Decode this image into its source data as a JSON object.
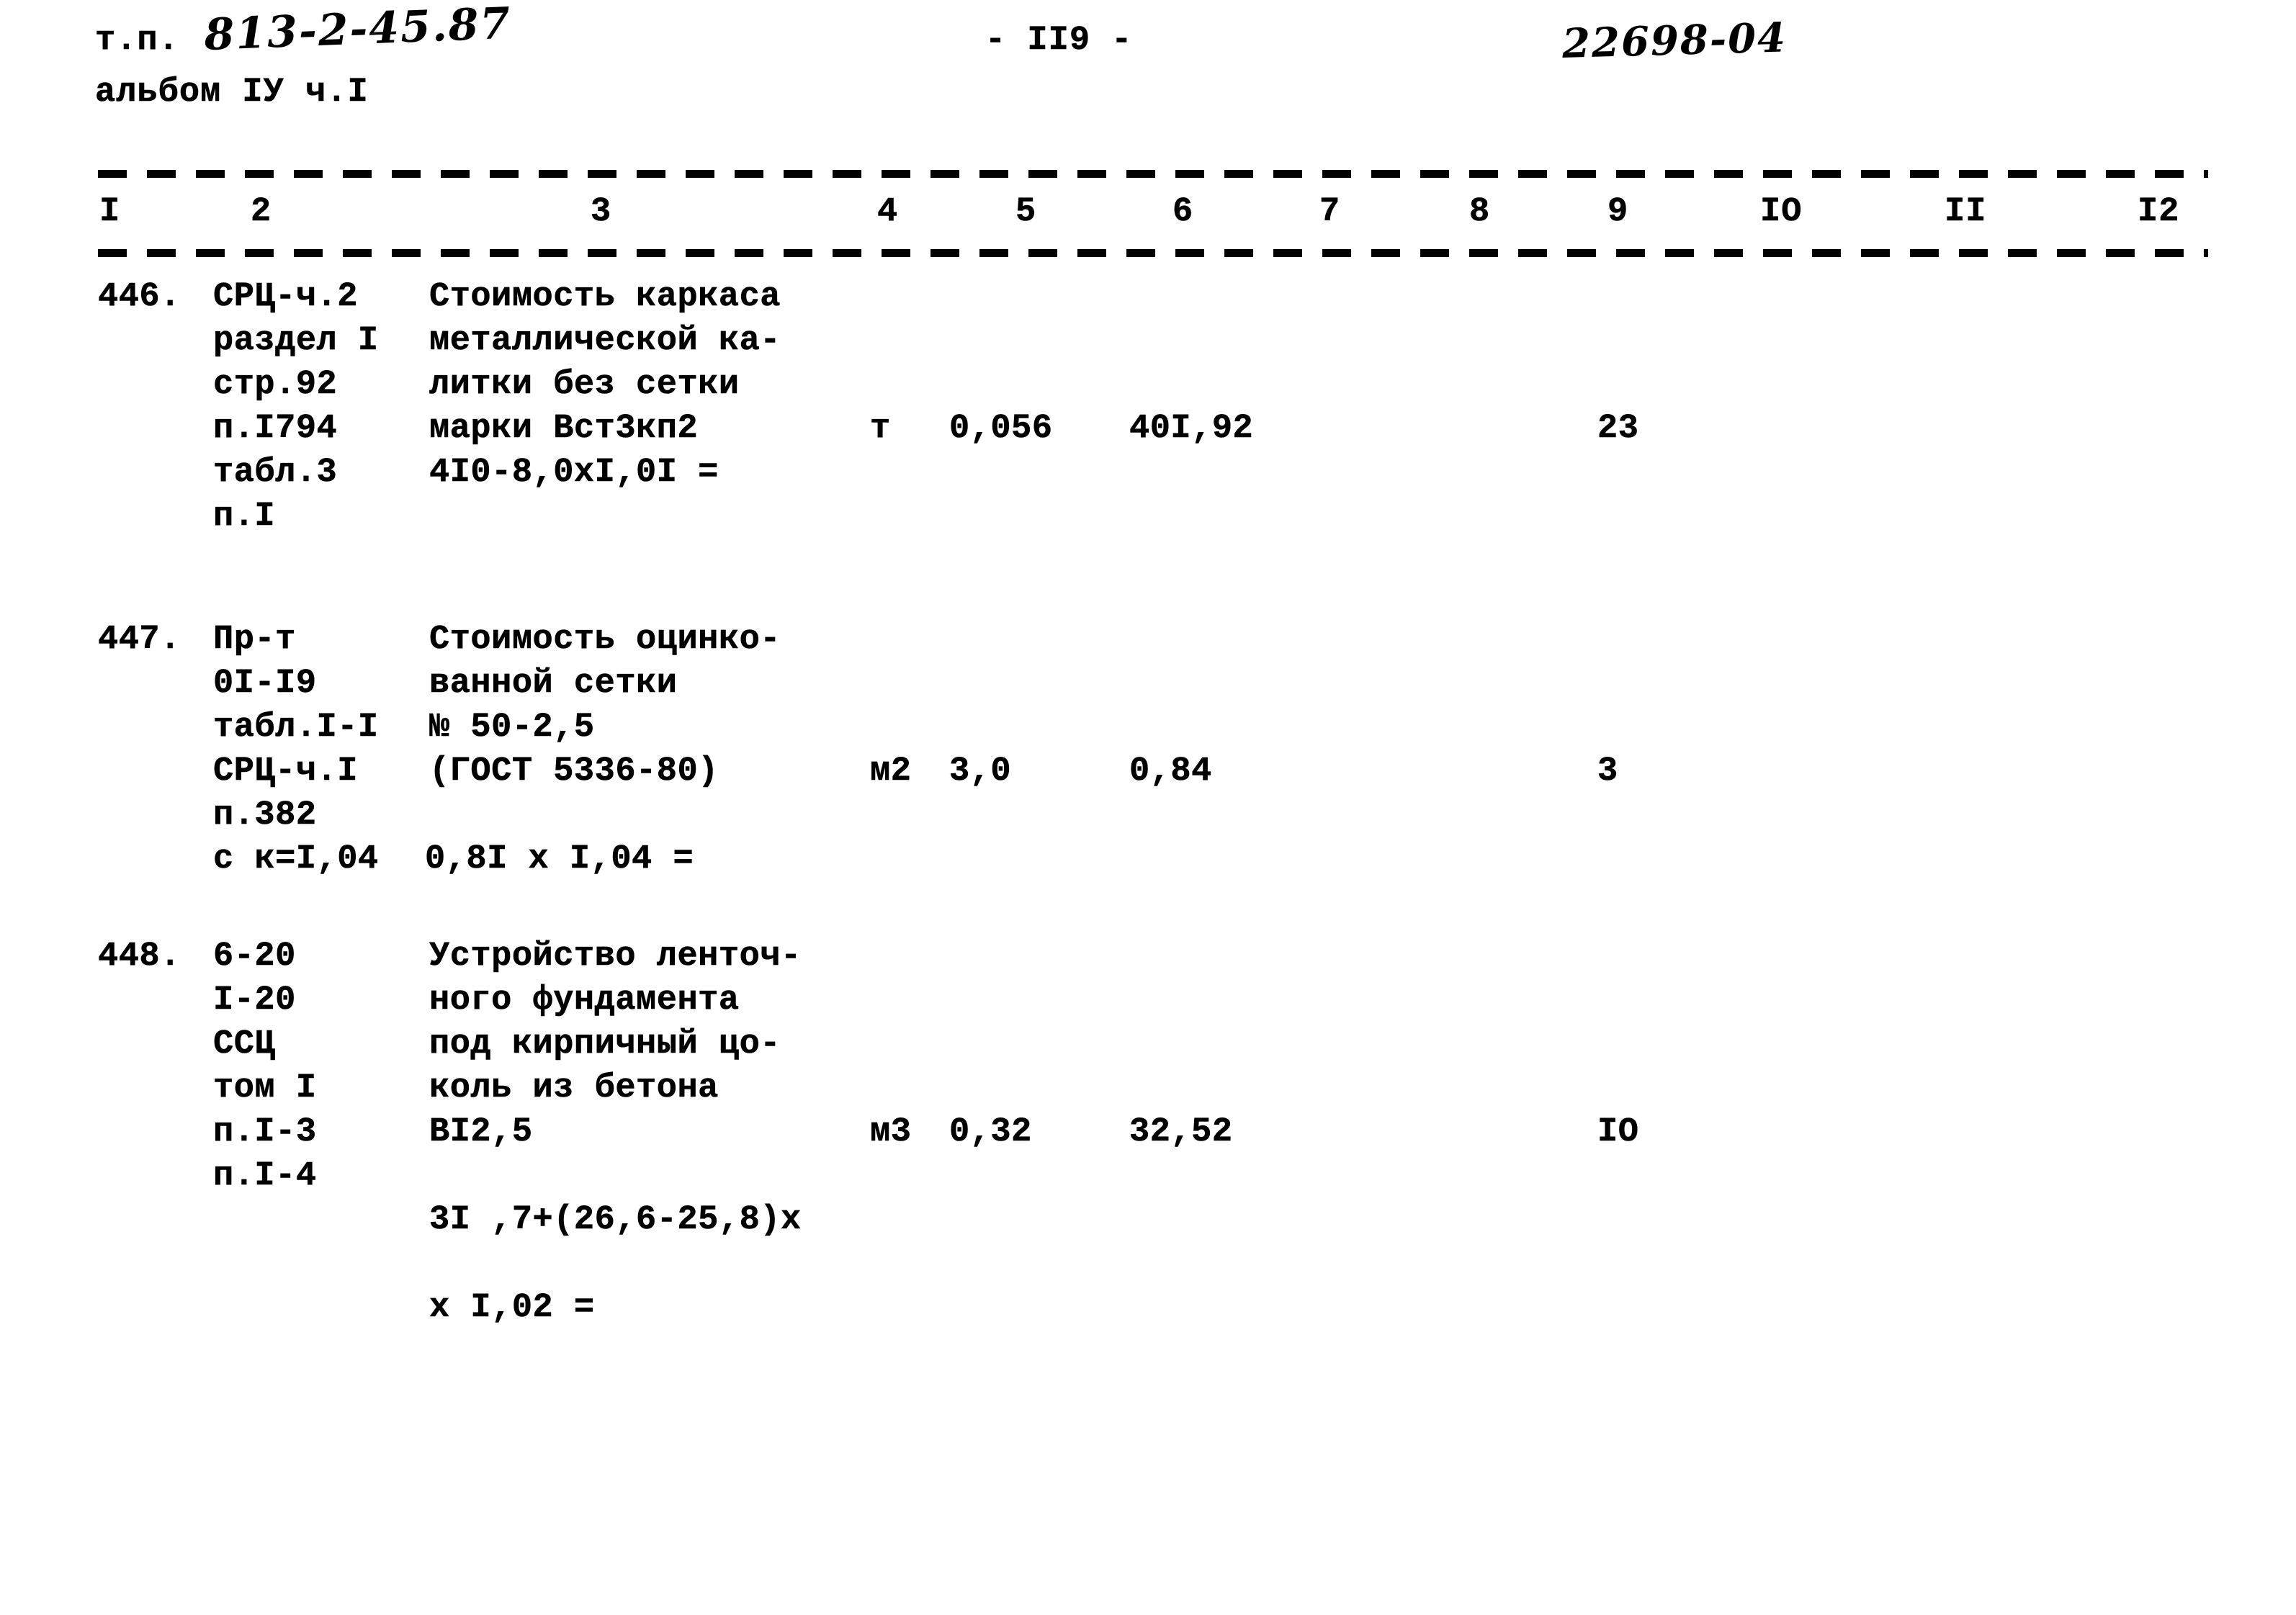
{
  "header": {
    "doc_code_prefix": "т.п.",
    "doc_code_hand": "813-2-45.87",
    "album_line": "альбом IУ ч.I",
    "page_number": "- II9 -",
    "archive_code": "22698-04"
  },
  "table": {
    "column_headers": [
      "I",
      "2",
      "3",
      "4",
      "5",
      "6",
      "7",
      "8",
      "9",
      "IO",
      "II",
      "I2"
    ],
    "rows": [
      {
        "number": "446.",
        "reference": "СРЦ-ч.2\nраздел I\nстр.92\nп.I794\nтабл.3\nп.I",
        "description": "Стоимость каркаса\nметаллической ка-\nлитки без сетки\nмарки Вст3кп2",
        "formula": "4I0-8,0xI,0I =",
        "unit": "т",
        "quantity": "0,056",
        "price": "40I,92",
        "col7": "",
        "col8": "",
        "col9": "23",
        "col10": "",
        "col11": "",
        "col12": ""
      },
      {
        "number": "447.",
        "reference": "Пр-т\n0I-I9\nтабл.I-I\nСРЦ-ч.I\nп.382\nс к=I,04",
        "description": "Стоимость оцинко-\nванной сетки\n№ 50-2,5\n(ГОСТ 5336-80)",
        "formula": "0,8I x I,04 =",
        "unit": "м2",
        "quantity": "3,0",
        "price": "0,84",
        "col7": "",
        "col8": "",
        "col9": "3",
        "col10": "",
        "col11": "",
        "col12": ""
      },
      {
        "number": "448.",
        "reference": "6-20\nI-20\nССЦ\nтом I\nп.I-3\nп.I-4",
        "description": "Устройство ленточ-\nного фундамента\nпод кирпичный цо-\nколь из бетона\nВI2,5",
        "formula": "3I ,7+(26,6-25,8)х\n\nх I,02 =",
        "unit": "м3",
        "quantity": "0,32",
        "price": "32,52",
        "col7": "",
        "col8": "",
        "col9": "IO",
        "col10": "",
        "col11": "",
        "col12": ""
      }
    ]
  }
}
